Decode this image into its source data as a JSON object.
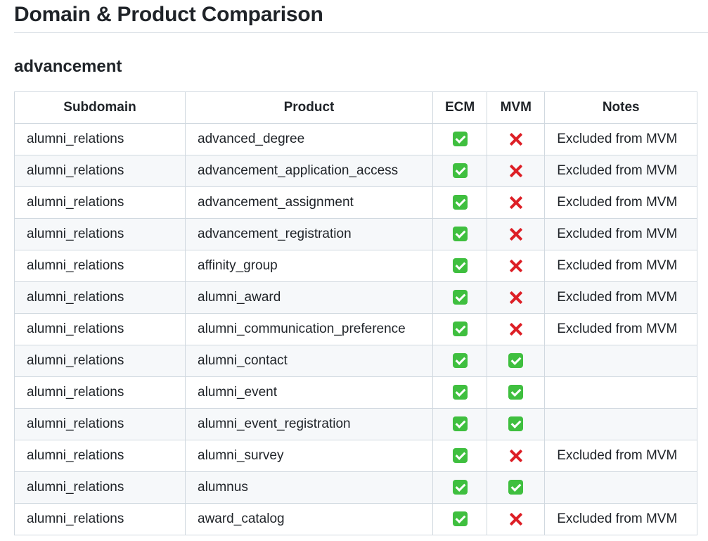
{
  "page": {
    "title": "Domain & Product Comparison"
  },
  "section": {
    "title": "advancement"
  },
  "table": {
    "headers": {
      "subdomain": "Subdomain",
      "product": "Product",
      "ecm": "ECM",
      "mvm": "MVM",
      "notes": "Notes"
    },
    "rows": [
      {
        "subdomain": "alumni_relations",
        "product": "advanced_degree",
        "ecm": "check-icon",
        "mvm": "cross-icon",
        "notes": "Excluded from MVM"
      },
      {
        "subdomain": "alumni_relations",
        "product": "advancement_application_access",
        "ecm": "check-icon",
        "mvm": "cross-icon",
        "notes": "Excluded from MVM"
      },
      {
        "subdomain": "alumni_relations",
        "product": "advancement_assignment",
        "ecm": "check-icon",
        "mvm": "cross-icon",
        "notes": "Excluded from MVM"
      },
      {
        "subdomain": "alumni_relations",
        "product": "advancement_registration",
        "ecm": "check-icon",
        "mvm": "cross-icon",
        "notes": "Excluded from MVM"
      },
      {
        "subdomain": "alumni_relations",
        "product": "affinity_group",
        "ecm": "check-icon",
        "mvm": "cross-icon",
        "notes": "Excluded from MVM"
      },
      {
        "subdomain": "alumni_relations",
        "product": "alumni_award",
        "ecm": "check-icon",
        "mvm": "cross-icon",
        "notes": "Excluded from MVM"
      },
      {
        "subdomain": "alumni_relations",
        "product": "alumni_communication_preference",
        "ecm": "check-icon",
        "mvm": "cross-icon",
        "notes": "Excluded from MVM"
      },
      {
        "subdomain": "alumni_relations",
        "product": "alumni_contact",
        "ecm": "check-icon",
        "mvm": "check-icon",
        "notes": ""
      },
      {
        "subdomain": "alumni_relations",
        "product": "alumni_event",
        "ecm": "check-icon",
        "mvm": "check-icon",
        "notes": ""
      },
      {
        "subdomain": "alumni_relations",
        "product": "alumni_event_registration",
        "ecm": "check-icon",
        "mvm": "check-icon",
        "notes": ""
      },
      {
        "subdomain": "alumni_relations",
        "product": "alumni_survey",
        "ecm": "check-icon",
        "mvm": "cross-icon",
        "notes": "Excluded from MVM"
      },
      {
        "subdomain": "alumni_relations",
        "product": "alumnus",
        "ecm": "check-icon",
        "mvm": "check-icon",
        "notes": ""
      },
      {
        "subdomain": "alumni_relations",
        "product": "award_catalog",
        "ecm": "check-icon",
        "mvm": "cross-icon",
        "notes": "Excluded from MVM"
      }
    ]
  },
  "colors": {
    "check": "#3fbf3f",
    "cross": "#dd1f26",
    "stripe": "#f6f8fa",
    "border": "#d1d9e0"
  }
}
